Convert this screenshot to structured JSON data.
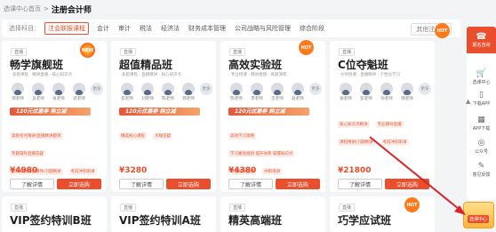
{
  "breadcrumb": {
    "parent": "选课中心首页",
    "sep": ">",
    "current": "注册会计师"
  },
  "filter": {
    "label": "选择科目：",
    "tabs": [
      "注会联报课程",
      "会计",
      "审计",
      "税法",
      "经济法",
      "财务成本管理",
      "公司战略与风险管理",
      "综合阶段"
    ],
    "active_index": 0,
    "right_button": "其他注会 ▾"
  },
  "cards": [
    {
      "tag": "直播",
      "title": "畅学旗舰班",
      "desc": "· 多套课程   · 精讲直播   · 核心知识点",
      "teachers": [
        "郭老师",
        "吴老师",
        "张老师",
        "武老师"
      ],
      "more": "更多",
      "promo": "120元优惠券  购立减",
      "chips": [
        "高频考点精讲/直播精讲题目",
        "专题辅导直播答疑",
        "历年真题精讲课件/习题精讲",
        "考前冲刺串讲"
      ],
      "price": "¥4980",
      "detail_btn": "了解详情",
      "buy_btn": "立即选购",
      "badge": "NEW"
    },
    {
      "tag": "直播",
      "title": "超值精品班",
      "desc": "· 多套课程   · 直播精讲   · 核心知识点",
      "teachers": [
        "彭老师",
        "刘老师",
        "陈老师",
        "郭老师"
      ],
      "more": "更多",
      "promo": "120元优惠券  购立减",
      "chips": [
        "精选核心课程",
        "大咖答疑"
      ],
      "price": "¥3280",
      "detail_btn": "了解详情",
      "buy_btn": "立即选购",
      "badge": ""
    },
    {
      "tag": "直播",
      "title": "高效实验班",
      "desc": "· 专业授课   · 精讲直播   · 真题演练",
      "teachers": [
        "陈老师",
        "李老师",
        "王老师",
        "赵老师"
      ],
      "more": "更多",
      "promo": "120元优惠券  购立减",
      "chips": [
        "高效学习攻略",
        "学习路径规划 提升效率 掌握知识点",
        "专业辅导直播",
        "冲刺串讲"
      ],
      "price": "¥4380",
      "detail_btn": "了解详情",
      "buy_btn": "立即选购",
      "badge": "HOT"
    },
    {
      "tag": "直播",
      "title": "C位夺魁班",
      "desc": "· 大师授课   · 直播精讲   · 个性化学习",
      "teachers": [
        "张老师",
        "彭老师",
        "孙老师",
        "郭老师"
      ],
      "more": "更多",
      "promo": "",
      "chips": [
        "核心知识点精讲",
        "专业辅导直播",
        "课程精讲/习题精讲",
        "考前冲刺串讲"
      ],
      "price": "¥21800",
      "detail_btn": "了解详情",
      "buy_btn": "立即选购",
      "badge": "HOT"
    },
    {
      "tag": "直播",
      "title": "VIP签约特训B班",
      "badge": ""
    },
    {
      "tag": "直播",
      "title": "VIP签约特训A班",
      "badge": ""
    },
    {
      "tag": "直播",
      "title": "精英高端班",
      "badge": ""
    },
    {
      "tag": "直播",
      "title": "巧学应试班",
      "badge": "HOT"
    }
  ],
  "sidebar": {
    "top_label": "报名咨询",
    "items": [
      "选课中心",
      "下载APP",
      "APP下载",
      "公众号",
      "意见反馈"
    ],
    "icons": [
      "cart-icon",
      "phone-icon",
      "qr-icon",
      "wechat-icon",
      "feedback-icon"
    ],
    "scroll_top": "▲"
  },
  "widget": {
    "label": "选课中心"
  },
  "colors": {
    "accent": "#e94e2d",
    "background": "#f3f4f6"
  }
}
